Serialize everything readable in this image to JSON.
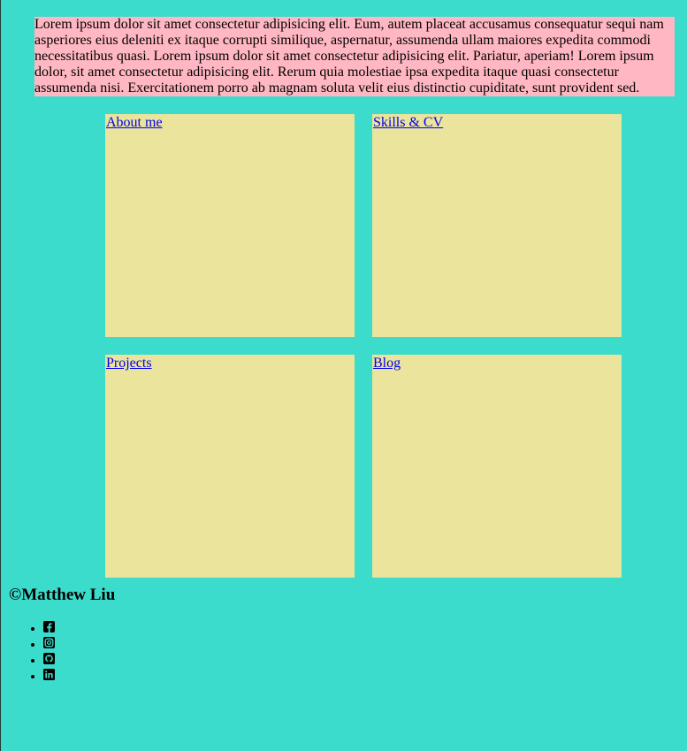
{
  "intro": {
    "text": "Lorem ipsum dolor sit amet consectetur adipisicing elit. Eum, autem placeat accusamus consequatur sequi nam asperiores eius deleniti ex itaque corrupti similique, aspernatur, assumenda ullam maiores expedita commodi necessitatibus quasi. Lorem ipsum dolor sit amet consectetur adipisicing elit. Pariatur, aperiam! Lorem ipsum dolor, sit amet consectetur adipisicing elit. Rerum quia molestiae ipsa expedita itaque quasi consectetur assumenda nisi. Exercitationem porro ab magnam soluta velit eius distinctio cupiditate, sunt provident sed."
  },
  "tiles": [
    {
      "label": "About me"
    },
    {
      "label": "Skills & CV"
    },
    {
      "label": "Projects"
    },
    {
      "label": "Blog"
    }
  ],
  "footer": {
    "title": "©Matthew Liu",
    "social": [
      {
        "icon": "facebook-icon"
      },
      {
        "icon": "instagram-icon"
      },
      {
        "icon": "github-icon"
      },
      {
        "icon": "linkedin-icon"
      }
    ]
  },
  "colors": {
    "background": "#3bdccb",
    "intro_background": "#ffb7c3",
    "tile_background": "#ebe49d",
    "link": "#0000ee"
  }
}
